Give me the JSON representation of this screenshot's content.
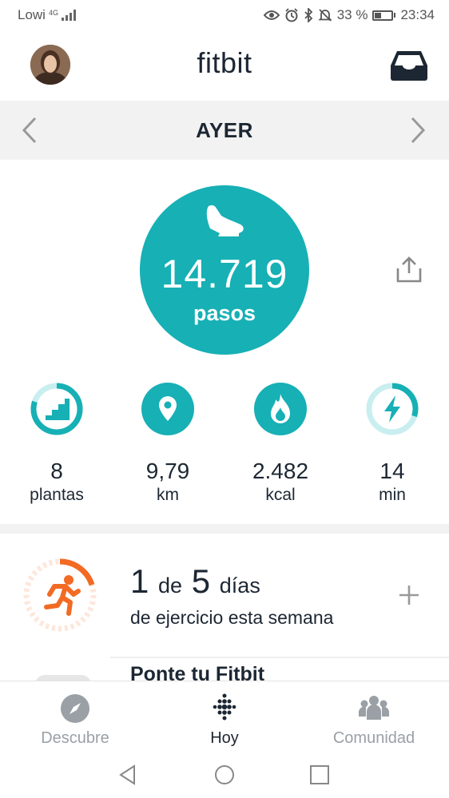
{
  "status_bar": {
    "carrier": "Lowi",
    "network": "4G",
    "battery": "33 %",
    "time": "23:34"
  },
  "header": {
    "logo": "fitbit",
    "icons": {
      "profile": "avatar",
      "inbox": "inbox-icon"
    }
  },
  "date_nav": {
    "label": "AYER",
    "icons": {
      "prev": "chevron-left-icon",
      "next": "chevron-right-icon"
    }
  },
  "steps": {
    "value": "14.719",
    "unit": "pasos",
    "icon": "shoe-icon",
    "share_icon": "share-icon"
  },
  "stats": [
    {
      "value": "8",
      "unit": "plantas",
      "icon": "stairs-icon",
      "progress": 0.8
    },
    {
      "value": "9,79",
      "unit": "km",
      "icon": "location-pin-icon",
      "progress": 1.0
    },
    {
      "value": "2.482",
      "unit": "kcal",
      "icon": "flame-icon",
      "progress": 1.0
    },
    {
      "value": "14",
      "unit": "min",
      "icon": "lightning-icon",
      "progress": 0.3
    }
  ],
  "exercise": {
    "count": "1",
    "connector": "de",
    "goal": "5",
    "period": "días",
    "subtitle": "de ejercicio esta semana",
    "icon": "runner-icon",
    "add_icon": "plus-icon",
    "progress": 0.2
  },
  "wear_card": {
    "title": "Ponte tu Fitbit"
  },
  "bottom_nav": [
    {
      "label": "Descubre",
      "icon": "compass-icon",
      "active": false
    },
    {
      "label": "Hoy",
      "icon": "fitbit-dots-icon",
      "active": true
    },
    {
      "label": "Comunidad",
      "icon": "people-icon",
      "active": false
    }
  ],
  "colors": {
    "teal": "#16b0b5",
    "teal_light": "#c9eef0",
    "orange": "#f26a23",
    "orange_light": "#fde7dc",
    "text": "#1c2733",
    "muted": "#9aa0a6"
  }
}
